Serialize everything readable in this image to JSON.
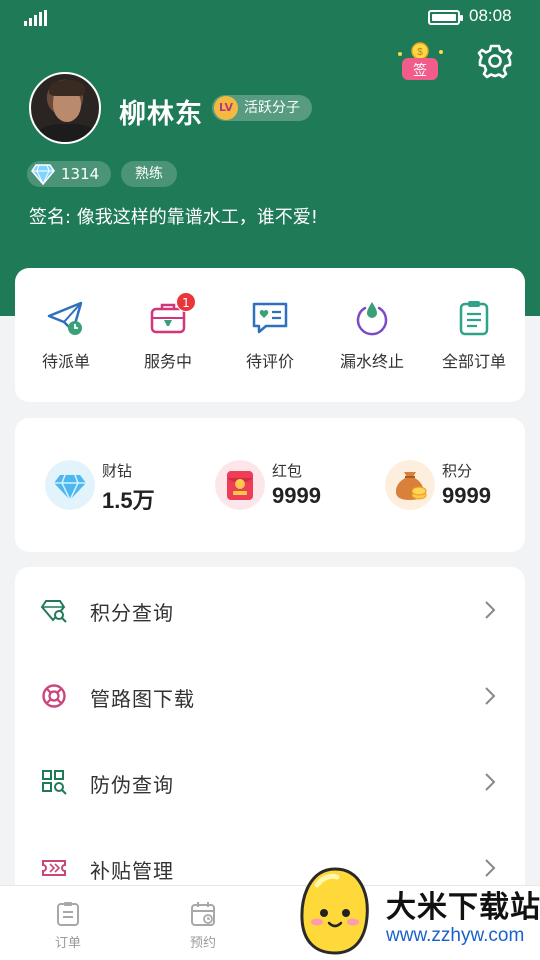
{
  "status_bar": {
    "time": "08:08"
  },
  "header": {
    "sign_label": "签"
  },
  "profile": {
    "name": "柳林东",
    "badge": {
      "level_mark": "LV",
      "label": "活跃分子"
    },
    "diamonds": "1314",
    "level": "熟练",
    "signature": "签名: 像我这样的靠谱水工，谁不爱!"
  },
  "orders": [
    {
      "label": "待派单",
      "icon": "paper-plane-clock-icon"
    },
    {
      "label": "服务中",
      "icon": "toolbox-icon",
      "badge": "1"
    },
    {
      "label": "待评价",
      "icon": "chat-heart-icon"
    },
    {
      "label": "漏水终止",
      "icon": "water-drop-icon"
    },
    {
      "label": "全部订单",
      "icon": "clipboard-icon"
    }
  ],
  "wallet": [
    {
      "title": "财钻",
      "value": "1.5万",
      "icon": "diamond-icon"
    },
    {
      "title": "红包",
      "value": "9999",
      "icon": "red-envelope-icon"
    },
    {
      "title": "积分",
      "value": "9999",
      "icon": "money-bag-icon"
    }
  ],
  "menu": [
    {
      "label": "积分查询",
      "icon": "gem-search-icon"
    },
    {
      "label": "管路图下载",
      "icon": "lifebuoy-icon"
    },
    {
      "label": "防伪查询",
      "icon": "qr-search-icon"
    },
    {
      "label": "补贴管理",
      "icon": "ticket-icon"
    }
  ],
  "bottom_nav": [
    {
      "label": "订单",
      "icon": "order-icon"
    },
    {
      "label": "预约",
      "icon": "calendar-icon"
    }
  ],
  "watermark": {
    "title": "大米下载站",
    "url": "www.zzhyw.com"
  },
  "colors": {
    "brand_green": "#1f7a57",
    "badge_red": "#e8363b",
    "watermark_blue": "#1a62c8"
  }
}
